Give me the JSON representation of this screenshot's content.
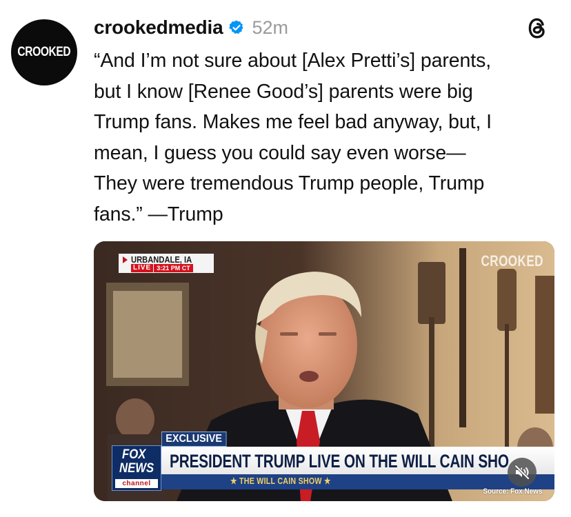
{
  "post": {
    "avatar_text": "CROOKED",
    "username": "crookedmedia",
    "time": "52m",
    "text": "“And I’m not sure about [Alex Pretti’s] parents,\nbut I know [Renee Good’s] parents were big\nTrump fans. Makes me feel bad anyway, but, I\nmean, I guess you could say even worse—\nThey were tremendous Trump people, Trump\nfans.” —Trump"
  },
  "icons": {
    "verified": "verified-badge-icon",
    "app": "threads-icon",
    "mute": "speaker-muted-icon"
  },
  "video": {
    "location": "URBANDALE, IA",
    "live_label": "LIVE",
    "live_time": "3:21 PM CT",
    "watermark": "CROOKED",
    "tag": "EXCLUSIVE",
    "headline": "PRESIDENT TRUMP LIVE ON THE WILL CAIN SHO",
    "show_name": "★ THE WILL CAIN SHOW ★",
    "network_line1": "FOX",
    "network_line2": "NEWS",
    "network_line3": "channel",
    "source": "Source: Fox News"
  },
  "colors": {
    "verified_blue": "#0095f6",
    "fox_red": "#d3131f",
    "fox_navy": "#1f4286"
  }
}
